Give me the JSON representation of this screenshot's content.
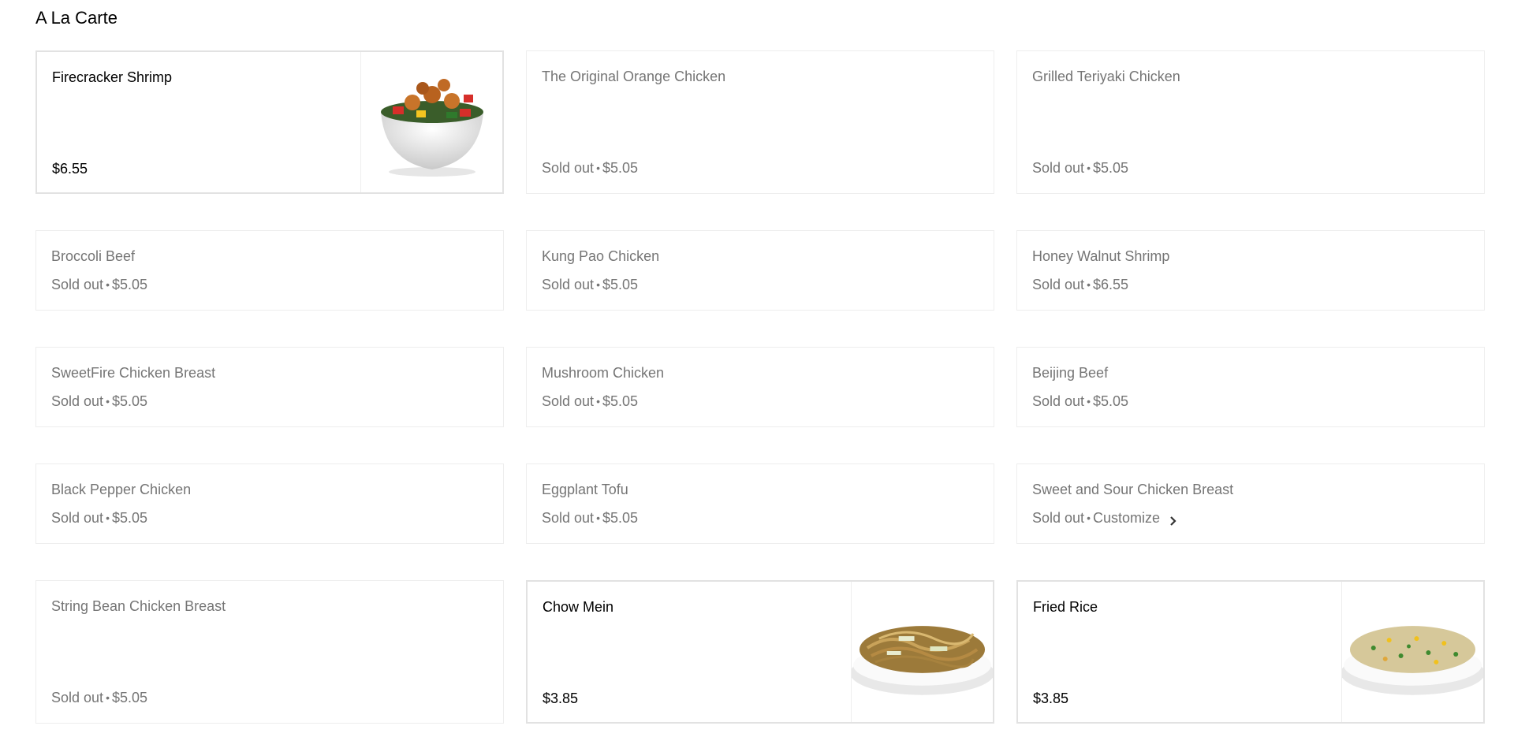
{
  "section": {
    "title": "A La Carte"
  },
  "separator": "•",
  "items": [
    {
      "name": "Firecracker Shrimp",
      "status": "",
      "price": "$6.55",
      "image": "shrimp-bowl"
    },
    {
      "name": "The Original Orange Chicken",
      "status": "Sold out",
      "price": "$5.05"
    },
    {
      "name": "Grilled Teriyaki Chicken",
      "status": "Sold out",
      "price": "$5.05"
    },
    {
      "name": "Broccoli Beef",
      "status": "Sold out",
      "price": "$5.05"
    },
    {
      "name": "Kung Pao Chicken",
      "status": "Sold out",
      "price": "$5.05"
    },
    {
      "name": "Honey Walnut Shrimp",
      "status": "Sold out",
      "price": "$6.55"
    },
    {
      "name": "SweetFire Chicken Breast",
      "status": "Sold out",
      "price": "$5.05"
    },
    {
      "name": "Mushroom Chicken",
      "status": "Sold out",
      "price": "$5.05"
    },
    {
      "name": "Beijing Beef",
      "status": "Sold out",
      "price": "$5.05"
    },
    {
      "name": "Black Pepper Chicken",
      "status": "Sold out",
      "price": "$5.05"
    },
    {
      "name": "Eggplant Tofu",
      "status": "Sold out",
      "price": "$5.05"
    },
    {
      "name": "Sweet and Sour Chicken Breast",
      "status": "Sold out",
      "action": "Customize",
      "icon": "chevron-right-icon"
    },
    {
      "name": "String Bean Chicken Breast",
      "status": "Sold out",
      "price": "$5.05"
    },
    {
      "name": "Chow Mein",
      "status": "",
      "price": "$3.85",
      "image": "noodle-plate"
    },
    {
      "name": "Fried Rice",
      "status": "",
      "price": "$3.85",
      "image": "rice-plate"
    }
  ],
  "colors": {
    "sold_out_text": "#757575",
    "available_text": "#000000",
    "border": "#eeeeee"
  }
}
